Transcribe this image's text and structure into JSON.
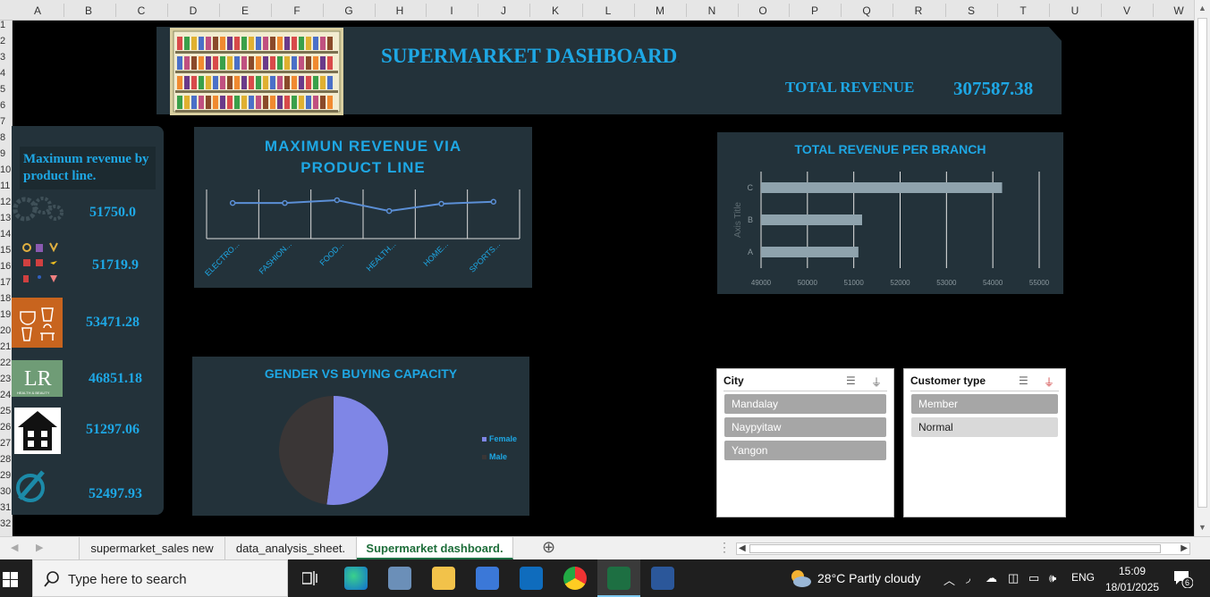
{
  "columns": [
    "A",
    "B",
    "C",
    "D",
    "E",
    "F",
    "G",
    "H",
    "I",
    "J",
    "K",
    "L",
    "M",
    "N",
    "O",
    "P",
    "Q",
    "R",
    "S",
    "T",
    "U",
    "V",
    "W"
  ],
  "rows": [
    "1",
    "2",
    "3",
    "4",
    "5",
    "6",
    "7",
    "8",
    "9",
    "10",
    "11",
    "12",
    "13",
    "14",
    "15",
    "16",
    "17",
    "18",
    "19",
    "20",
    "21",
    "22",
    "23",
    "24",
    "25",
    "26",
    "27",
    "28",
    "29",
    "30",
    "31",
    "32"
  ],
  "dashboard": {
    "title": "SUPERMARKET DASHBOARD",
    "title_dot": ".",
    "total_revenue_label": "TOTAL REVENUE",
    "total_revenue_value": "307587.38"
  },
  "sidebar": {
    "heading": "Maximum revenue by product line.",
    "items": [
      {
        "value": "51750.0",
        "icon": "gears-icon"
      },
      {
        "value": "51719.9",
        "icon": "fashion-accessories-icon"
      },
      {
        "value": "53471.28",
        "icon": "food-drinks-icon"
      },
      {
        "value": "46851.18",
        "icon": "health-beauty-logo-icon"
      },
      {
        "value": "51297.06",
        "icon": "home-icon"
      },
      {
        "value": "52497.93",
        "icon": "sports-icon"
      }
    ]
  },
  "chart_data": [
    {
      "type": "line",
      "title": "MAXIMUN REVENUE VIA PRODUCT LINE",
      "categories": [
        "ELECTRO...",
        "FASHION...",
        "FOOD...",
        "HEALTH...",
        "HOME...",
        "SPORTS..."
      ],
      "values": [
        51750.0,
        51719.9,
        53471.28,
        46851.18,
        51297.06,
        52497.93
      ],
      "ylim": [
        30000,
        60000
      ],
      "grid": true,
      "color": "#5b8fd6"
    },
    {
      "type": "bar",
      "orientation": "horizontal",
      "title": "TOTAL REVENUE PER BRANCH",
      "categories": [
        "A",
        "B",
        "C"
      ],
      "values": [
        51100,
        51180,
        54200
      ],
      "ylabel": "Axis Title",
      "xlim": [
        49000,
        55000
      ],
      "xticks": [
        "49000",
        "50000",
        "51000",
        "52000",
        "53000",
        "54000",
        "55000"
      ],
      "grid": true,
      "color": "#8fa3ad"
    },
    {
      "type": "pie",
      "title": "GENDER VS BUYING CAPACITY",
      "series": [
        {
          "name": "Female",
          "value": 52,
          "color": "#7f86e6"
        },
        {
          "name": "Male",
          "value": 48,
          "color": "#3a3636"
        }
      ],
      "legend": "right"
    }
  ],
  "slicers": {
    "city": {
      "header": "City",
      "items": [
        "Mandalay",
        "Naypyitaw",
        "Yangon"
      ]
    },
    "customer_type": {
      "header": "Customer type",
      "items": [
        "Member",
        "Normal"
      ]
    }
  },
  "sheet_tabs": [
    "supermarket_sales new",
    "data_analysis_sheet.",
    "Supermarket dashboard."
  ],
  "taskbar": {
    "search_placeholder": "Type here to search",
    "weather": "28°C  Partly cloudy",
    "language": "ENG",
    "time": "15:09",
    "date": "18/01/2025",
    "notification_count": "6"
  }
}
